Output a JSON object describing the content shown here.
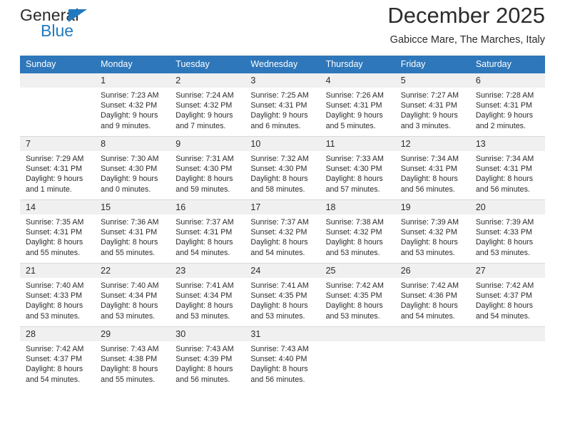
{
  "brand": {
    "name_dark": "General",
    "name_blue": "Blue",
    "accent_color": "#1f7ac0"
  },
  "header": {
    "title": "December 2025",
    "subtitle": "Gabicce Mare, The Marches, Italy",
    "header_bg": "#2e77ba",
    "daynum_bg": "#f0f0f0"
  },
  "calendar": {
    "weekday_headers": [
      "Sunday",
      "Monday",
      "Tuesday",
      "Wednesday",
      "Thursday",
      "Friday",
      "Saturday"
    ],
    "weeks": [
      [
        {
          "day": "",
          "lines": []
        },
        {
          "day": "1",
          "lines": [
            "Sunrise: 7:23 AM",
            "Sunset: 4:32 PM",
            "Daylight: 9 hours",
            "and 9 minutes."
          ]
        },
        {
          "day": "2",
          "lines": [
            "Sunrise: 7:24 AM",
            "Sunset: 4:32 PM",
            "Daylight: 9 hours",
            "and 7 minutes."
          ]
        },
        {
          "day": "3",
          "lines": [
            "Sunrise: 7:25 AM",
            "Sunset: 4:31 PM",
            "Daylight: 9 hours",
            "and 6 minutes."
          ]
        },
        {
          "day": "4",
          "lines": [
            "Sunrise: 7:26 AM",
            "Sunset: 4:31 PM",
            "Daylight: 9 hours",
            "and 5 minutes."
          ]
        },
        {
          "day": "5",
          "lines": [
            "Sunrise: 7:27 AM",
            "Sunset: 4:31 PM",
            "Daylight: 9 hours",
            "and 3 minutes."
          ]
        },
        {
          "day": "6",
          "lines": [
            "Sunrise: 7:28 AM",
            "Sunset: 4:31 PM",
            "Daylight: 9 hours",
            "and 2 minutes."
          ]
        }
      ],
      [
        {
          "day": "7",
          "lines": [
            "Sunrise: 7:29 AM",
            "Sunset: 4:31 PM",
            "Daylight: 9 hours",
            "and 1 minute."
          ]
        },
        {
          "day": "8",
          "lines": [
            "Sunrise: 7:30 AM",
            "Sunset: 4:30 PM",
            "Daylight: 9 hours",
            "and 0 minutes."
          ]
        },
        {
          "day": "9",
          "lines": [
            "Sunrise: 7:31 AM",
            "Sunset: 4:30 PM",
            "Daylight: 8 hours",
            "and 59 minutes."
          ]
        },
        {
          "day": "10",
          "lines": [
            "Sunrise: 7:32 AM",
            "Sunset: 4:30 PM",
            "Daylight: 8 hours",
            "and 58 minutes."
          ]
        },
        {
          "day": "11",
          "lines": [
            "Sunrise: 7:33 AM",
            "Sunset: 4:30 PM",
            "Daylight: 8 hours",
            "and 57 minutes."
          ]
        },
        {
          "day": "12",
          "lines": [
            "Sunrise: 7:34 AM",
            "Sunset: 4:31 PM",
            "Daylight: 8 hours",
            "and 56 minutes."
          ]
        },
        {
          "day": "13",
          "lines": [
            "Sunrise: 7:34 AM",
            "Sunset: 4:31 PM",
            "Daylight: 8 hours",
            "and 56 minutes."
          ]
        }
      ],
      [
        {
          "day": "14",
          "lines": [
            "Sunrise: 7:35 AM",
            "Sunset: 4:31 PM",
            "Daylight: 8 hours",
            "and 55 minutes."
          ]
        },
        {
          "day": "15",
          "lines": [
            "Sunrise: 7:36 AM",
            "Sunset: 4:31 PM",
            "Daylight: 8 hours",
            "and 55 minutes."
          ]
        },
        {
          "day": "16",
          "lines": [
            "Sunrise: 7:37 AM",
            "Sunset: 4:31 PM",
            "Daylight: 8 hours",
            "and 54 minutes."
          ]
        },
        {
          "day": "17",
          "lines": [
            "Sunrise: 7:37 AM",
            "Sunset: 4:32 PM",
            "Daylight: 8 hours",
            "and 54 minutes."
          ]
        },
        {
          "day": "18",
          "lines": [
            "Sunrise: 7:38 AM",
            "Sunset: 4:32 PM",
            "Daylight: 8 hours",
            "and 53 minutes."
          ]
        },
        {
          "day": "19",
          "lines": [
            "Sunrise: 7:39 AM",
            "Sunset: 4:32 PM",
            "Daylight: 8 hours",
            "and 53 minutes."
          ]
        },
        {
          "day": "20",
          "lines": [
            "Sunrise: 7:39 AM",
            "Sunset: 4:33 PM",
            "Daylight: 8 hours",
            "and 53 minutes."
          ]
        }
      ],
      [
        {
          "day": "21",
          "lines": [
            "Sunrise: 7:40 AM",
            "Sunset: 4:33 PM",
            "Daylight: 8 hours",
            "and 53 minutes."
          ]
        },
        {
          "day": "22",
          "lines": [
            "Sunrise: 7:40 AM",
            "Sunset: 4:34 PM",
            "Daylight: 8 hours",
            "and 53 minutes."
          ]
        },
        {
          "day": "23",
          "lines": [
            "Sunrise: 7:41 AM",
            "Sunset: 4:34 PM",
            "Daylight: 8 hours",
            "and 53 minutes."
          ]
        },
        {
          "day": "24",
          "lines": [
            "Sunrise: 7:41 AM",
            "Sunset: 4:35 PM",
            "Daylight: 8 hours",
            "and 53 minutes."
          ]
        },
        {
          "day": "25",
          "lines": [
            "Sunrise: 7:42 AM",
            "Sunset: 4:35 PM",
            "Daylight: 8 hours",
            "and 53 minutes."
          ]
        },
        {
          "day": "26",
          "lines": [
            "Sunrise: 7:42 AM",
            "Sunset: 4:36 PM",
            "Daylight: 8 hours",
            "and 54 minutes."
          ]
        },
        {
          "day": "27",
          "lines": [
            "Sunrise: 7:42 AM",
            "Sunset: 4:37 PM",
            "Daylight: 8 hours",
            "and 54 minutes."
          ]
        }
      ],
      [
        {
          "day": "28",
          "lines": [
            "Sunrise: 7:42 AM",
            "Sunset: 4:37 PM",
            "Daylight: 8 hours",
            "and 54 minutes."
          ]
        },
        {
          "day": "29",
          "lines": [
            "Sunrise: 7:43 AM",
            "Sunset: 4:38 PM",
            "Daylight: 8 hours",
            "and 55 minutes."
          ]
        },
        {
          "day": "30",
          "lines": [
            "Sunrise: 7:43 AM",
            "Sunset: 4:39 PM",
            "Daylight: 8 hours",
            "and 56 minutes."
          ]
        },
        {
          "day": "31",
          "lines": [
            "Sunrise: 7:43 AM",
            "Sunset: 4:40 PM",
            "Daylight: 8 hours",
            "and 56 minutes."
          ]
        },
        {
          "day": "",
          "lines": []
        },
        {
          "day": "",
          "lines": []
        },
        {
          "day": "",
          "lines": []
        }
      ]
    ]
  }
}
